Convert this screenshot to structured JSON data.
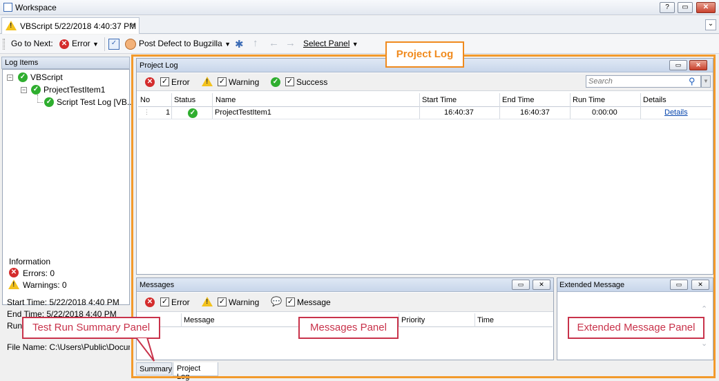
{
  "window": {
    "title": "Workspace",
    "help_btn": "?",
    "restore_btn": "▭",
    "close_btn": "✕"
  },
  "doc_tab": {
    "label": "VBScript 5/22/2018 4:40:37 PM",
    "close": "✕",
    "dropdown": "⌄"
  },
  "toolbar": {
    "go_to_next": "Go to Next:",
    "error_filter": "Error",
    "post_defect": "Post Defect to Bugzilla",
    "select_panel": "Select Panel"
  },
  "log_items": {
    "header": "Log Items",
    "tree": [
      {
        "label": "VBScript"
      },
      {
        "label": "ProjectTestItem1"
      },
      {
        "label": "Script Test Log [VB..."
      }
    ]
  },
  "information": {
    "title": "Information",
    "errors": "Errors: 0",
    "warnings": "Warnings: 0",
    "start_time": "Start Time: 5/22/2018 4:40 PM",
    "end_time": "End Time: 5/22/2018 4:40 PM",
    "run_time": "Run",
    "file_name": "File Name: C:\\Users\\Public\\Documen"
  },
  "project_log": {
    "header": "Project Log",
    "filters": {
      "error": "Error",
      "warning": "Warning",
      "success": "Success"
    },
    "search_placeholder": "Search",
    "columns": [
      "No",
      "Status",
      "Name",
      "Start Time",
      "End Time",
      "Run Time",
      "Details"
    ],
    "rows": [
      {
        "no": "1",
        "name": "ProjectTestItem1",
        "start": "16:40:37",
        "end": "16:40:37",
        "run": "0:00:00",
        "details": "Details"
      }
    ]
  },
  "messages": {
    "header": "Messages",
    "filters": {
      "error": "Error",
      "warning": "Warning",
      "message": "Message"
    },
    "columns": [
      "Message",
      "Priority",
      "Time"
    ]
  },
  "extended_message": {
    "header": "Extended Message"
  },
  "bottom_tabs": [
    "Summary",
    "Project Log"
  ],
  "callouts": {
    "project_log": "Project Log",
    "test_run_summary": "Test Run Summary Panel",
    "messages_panel": "Messages Panel",
    "extended_message_panel": "Extended Message Panel"
  },
  "colors": {
    "accent_orange": "#f39a2b",
    "callout_red": "#c8324a",
    "link": "#0645ad"
  }
}
